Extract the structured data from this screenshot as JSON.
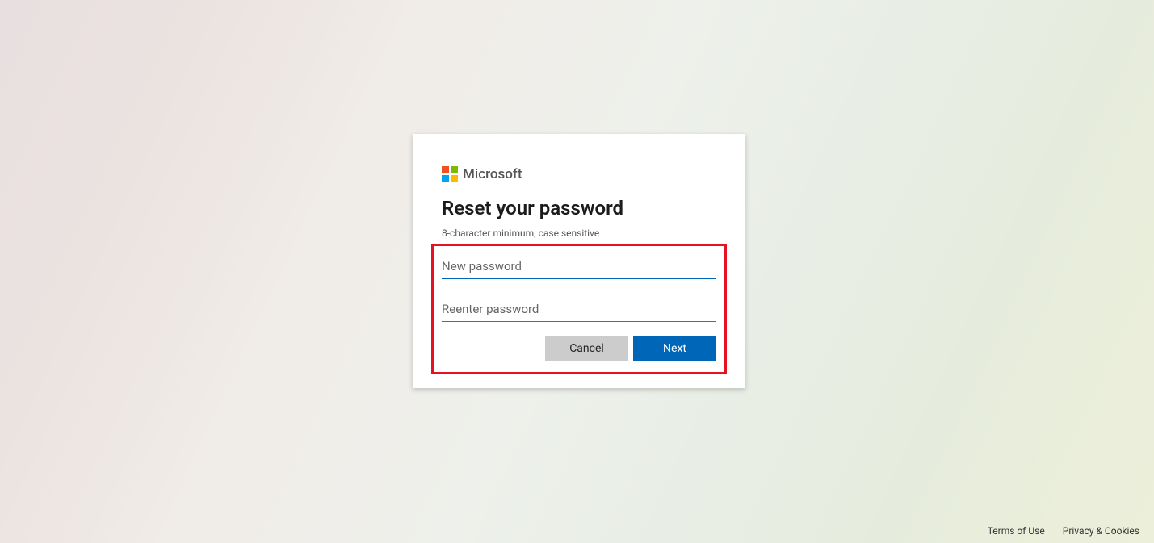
{
  "brand": {
    "name": "Microsoft"
  },
  "form": {
    "title": "Reset your password",
    "hint": "8-character minimum; case sensitive",
    "new_password_placeholder": "New password",
    "reenter_password_placeholder": "Reenter password",
    "cancel_label": "Cancel",
    "next_label": "Next"
  },
  "footer": {
    "terms": "Terms of Use",
    "privacy": "Privacy & Cookies"
  }
}
